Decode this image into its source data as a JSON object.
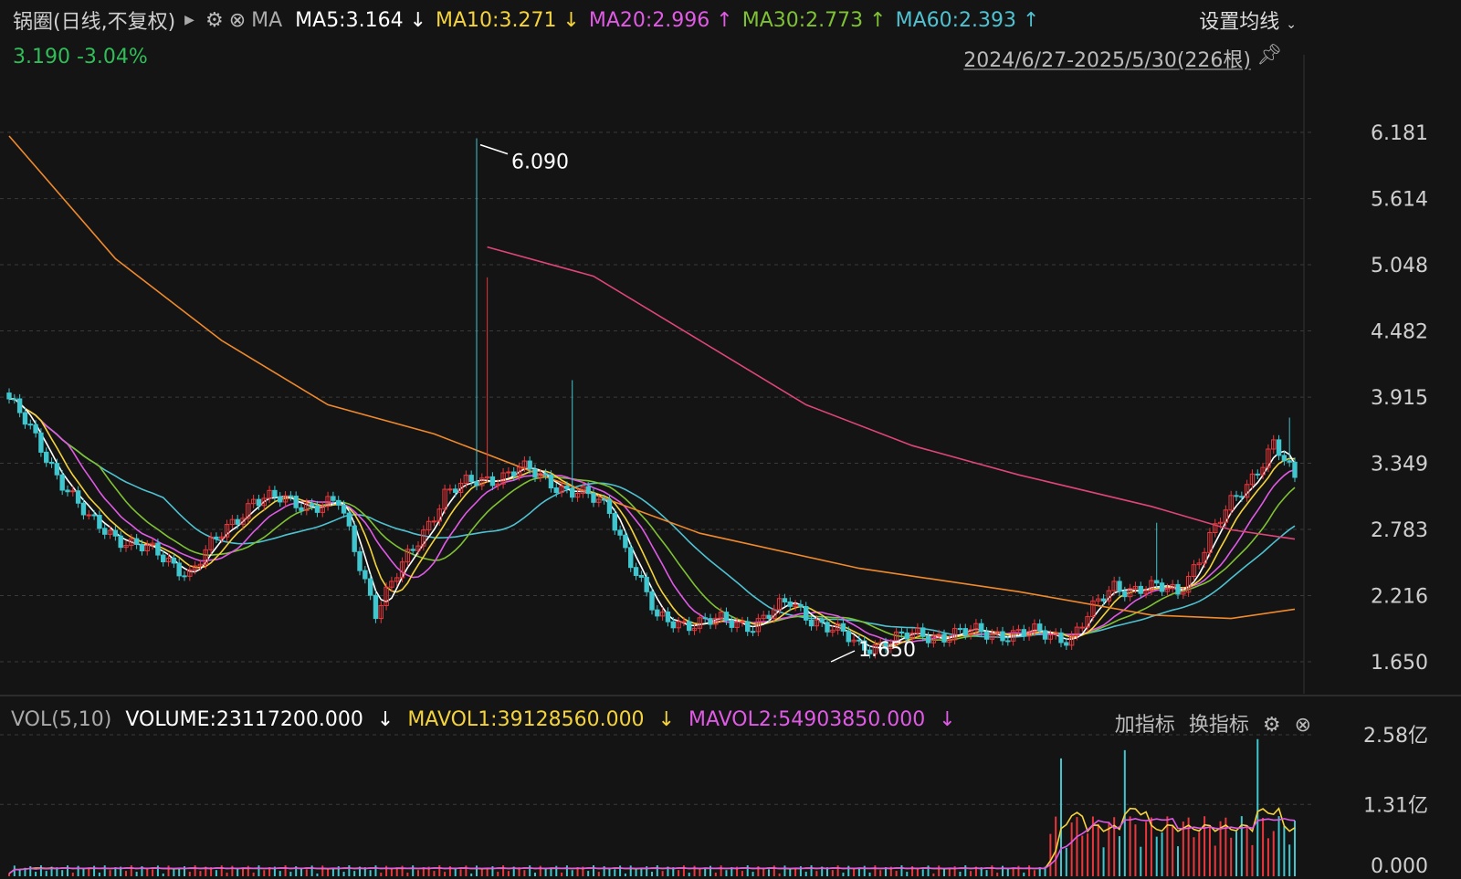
{
  "header": {
    "stock_name": "锅圈(日线,不复权)",
    "ma_label": "MA",
    "ma_items": [
      {
        "label": "MA5:3.164",
        "arrow": "↓",
        "color": "#ffffff"
      },
      {
        "label": "MA10:3.271",
        "arrow": "↓",
        "color": "#f5d33a"
      },
      {
        "label": "MA20:2.996",
        "arrow": "↑",
        "color": "#e05ae6"
      },
      {
        "label": "MA30:2.773",
        "arrow": "↑",
        "color": "#7ec234"
      },
      {
        "label": "MA60:2.393",
        "arrow": "↑",
        "color": "#4fc2d2"
      }
    ],
    "settings_label": "设置均线",
    "price": "3.190",
    "change": "-3.04%",
    "date_range": "2024/6/27-2025/5/30(226根)"
  },
  "volume_header": {
    "title": "VOL(5,10)",
    "volume": "VOLUME:23117200.000",
    "volume_arrow": "↓",
    "mavol1": "MAVOL1:39128560.000",
    "mavol1_arrow": "↓",
    "mavol2": "MAVOL2:54903850.000",
    "mavol2_arrow": "↓",
    "add_indicator": "加指标",
    "switch_indicator": "换指标"
  },
  "colors": {
    "up": "#e8383d",
    "down": "#3fc6cf",
    "ma5": "#ffffff",
    "ma10": "#f5d33a",
    "ma20": "#e05ae6",
    "ma30": "#7ec234",
    "ma60": "#4fc2d2",
    "ma120": "#f08a2c",
    "ma250": "#e0457a"
  },
  "chart_data": [
    {
      "type": "candlestick",
      "title": "锅圈(日线,不复权)",
      "y_ticks": [
        6.181,
        5.614,
        5.048,
        4.482,
        3.915,
        3.349,
        2.783,
        2.216,
        1.65
      ],
      "ylim": [
        1.65,
        6.181
      ],
      "annotations": [
        {
          "label": "6.090",
          "value": 6.09,
          "note": "period high"
        },
        {
          "label": "1.650",
          "value": 1.65,
          "note": "period low"
        }
      ],
      "key_prices": [
        {
          "x": 0,
          "close": 3.9
        },
        {
          "x": 15,
          "close": 2.85
        },
        {
          "x": 34,
          "close": 2.42
        },
        {
          "x": 46,
          "close": 3.05
        },
        {
          "x": 57,
          "close": 3.0
        },
        {
          "x": 62,
          "close": 3.0
        },
        {
          "x": 69,
          "close": 2.1
        },
        {
          "x": 76,
          "close": 2.6
        },
        {
          "x": 82,
          "close": 3.1
        },
        {
          "x": 96,
          "close": 3.3
        },
        {
          "x": 107,
          "close": 3.1
        },
        {
          "x": 113,
          "close": 2.95
        },
        {
          "x": 122,
          "close": 2.0
        },
        {
          "x": 140,
          "close": 1.98
        },
        {
          "x": 147,
          "close": 2.15
        },
        {
          "x": 160,
          "close": 1.78
        },
        {
          "x": 172,
          "close": 1.88
        },
        {
          "x": 186,
          "close": 1.9
        },
        {
          "x": 200,
          "close": 1.87
        },
        {
          "x": 208,
          "close": 2.3
        },
        {
          "x": 220,
          "close": 2.25
        },
        {
          "x": 230,
          "close": 3.0
        },
        {
          "x": 238,
          "close": 3.5
        },
        {
          "x": 242,
          "close": 3.2
        }
      ],
      "series": [
        {
          "name": "MA5",
          "value": 3.164
        },
        {
          "name": "MA10",
          "value": 3.271
        },
        {
          "name": "MA20",
          "value": 2.996
        },
        {
          "name": "MA30",
          "value": 2.773
        },
        {
          "name": "MA60",
          "value": 2.393
        }
      ],
      "extra_ma_lines": [
        {
          "key": "ma120",
          "points": [
            [
              0,
              6.15
            ],
            [
              20,
              5.1
            ],
            [
              40,
              4.4
            ],
            [
              60,
              3.85
            ],
            [
              80,
              3.6
            ],
            [
              100,
              3.25
            ],
            [
              130,
              2.75
            ],
            [
              160,
              2.45
            ],
            [
              190,
              2.25
            ],
            [
              215,
              2.05
            ],
            [
              230,
              2.02
            ],
            [
              242,
              2.1
            ]
          ]
        },
        {
          "key": "ma250",
          "points": [
            [
              90,
              5.2
            ],
            [
              110,
              4.95
            ],
            [
              130,
              4.4
            ],
            [
              150,
              3.85
            ],
            [
              170,
              3.5
            ],
            [
              190,
              3.25
            ],
            [
              215,
              2.98
            ],
            [
              230,
              2.78
            ],
            [
              242,
              2.7
            ]
          ]
        }
      ]
    },
    {
      "type": "bar",
      "title": "VOL(5,10)",
      "y_ticks": [
        "2.58亿",
        "1.31亿",
        "0.000"
      ],
      "ylim": [
        0,
        2.58
      ],
      "unit": "亿",
      "series": [
        {
          "name": "VOLUME",
          "value": 23117200
        },
        {
          "name": "MAVOL1",
          "value": 39128560
        },
        {
          "name": "MAVOL2",
          "value": 54903850
        }
      ]
    }
  ]
}
